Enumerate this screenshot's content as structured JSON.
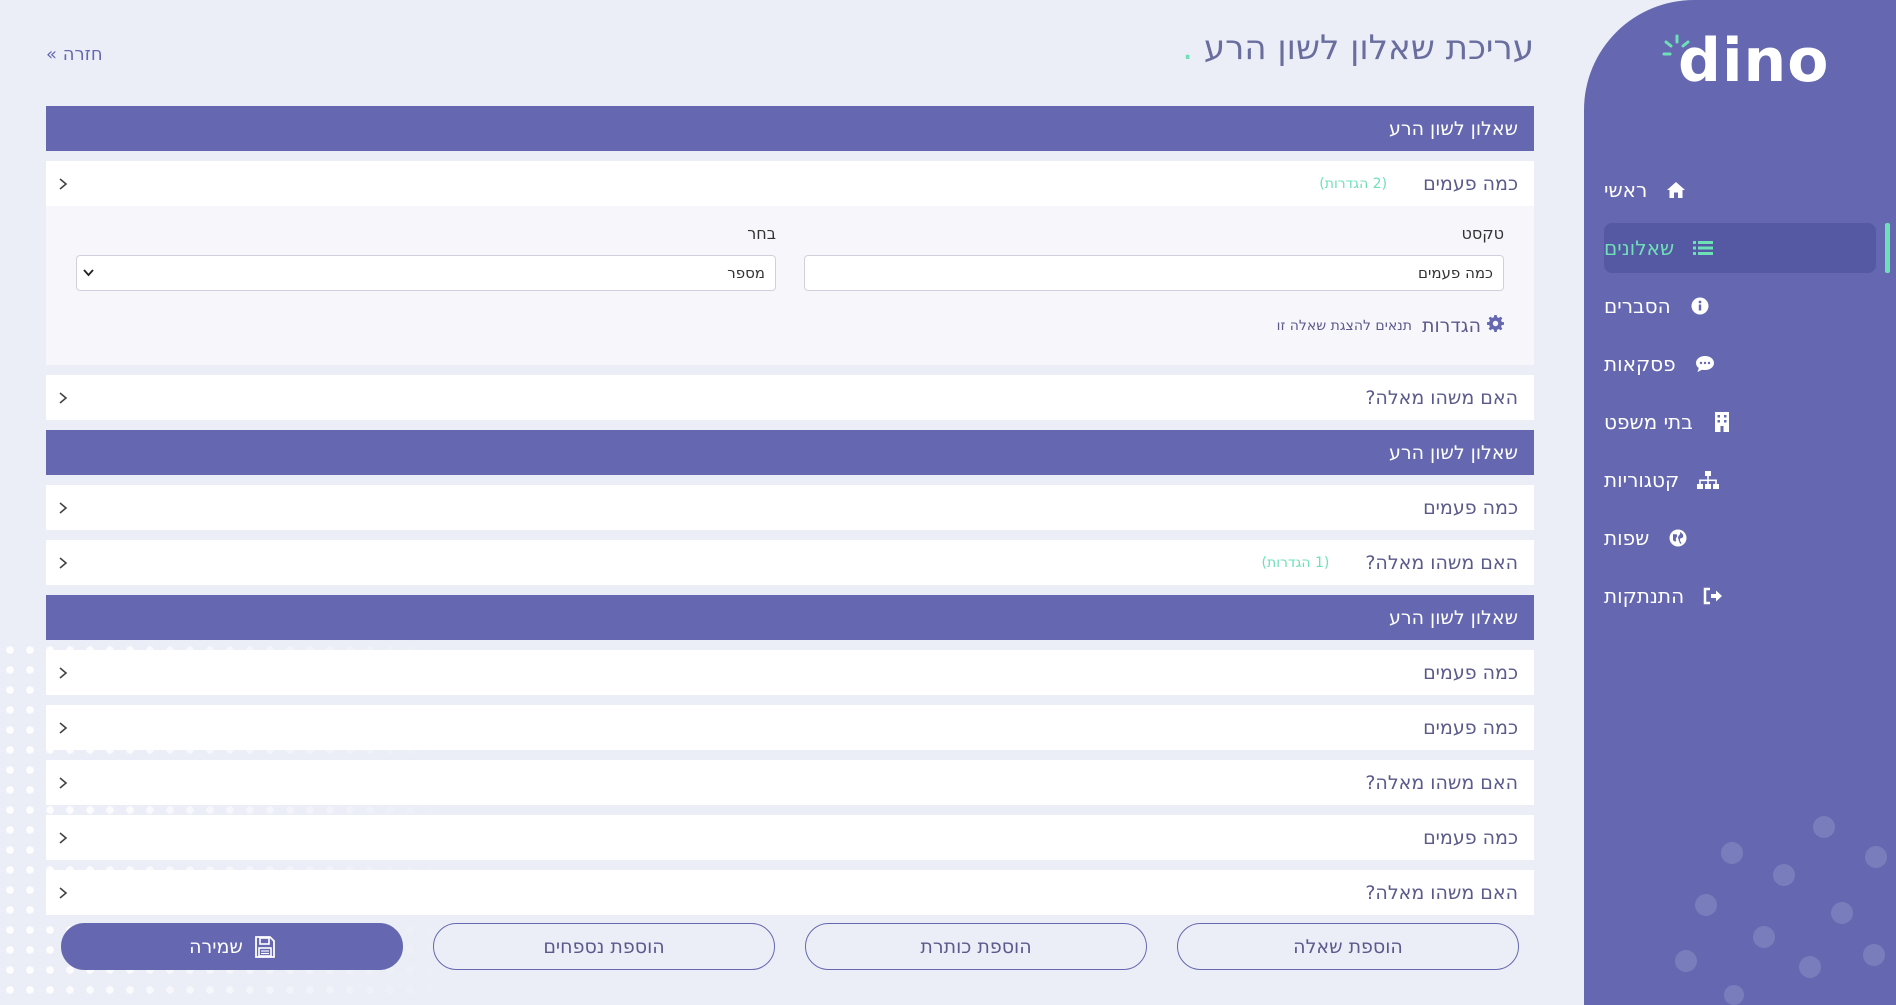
{
  "app": {
    "logo_text": "dino"
  },
  "header": {
    "title": "עריכת שאלון לשון הרע",
    "title_dot": ".",
    "back": "חזרה »"
  },
  "nav": {
    "items": [
      {
        "label": "ראשי",
        "icon": "home-icon"
      },
      {
        "label": "שאלונים",
        "icon": "list-icon",
        "active": true
      },
      {
        "label": "הסברים",
        "icon": "info-icon"
      },
      {
        "label": "פסקאות",
        "icon": "comment-icon"
      },
      {
        "label": "בתי משפט",
        "icon": "building-icon"
      },
      {
        "label": "קטגוריות",
        "icon": "sitemap-icon"
      },
      {
        "label": "שפות",
        "icon": "globe-icon"
      },
      {
        "label": "התנתקות",
        "icon": "sign-out-icon"
      }
    ]
  },
  "sections": [
    {
      "title": "שאלון לשון הרע"
    },
    {
      "title": "שאלון לשון הרע"
    },
    {
      "title": "שאלון לשון הרע"
    }
  ],
  "questions": {
    "q1": {
      "label": "כמה פעמים",
      "badge": "(2 הגדרות)"
    },
    "q2": {
      "label": "האם משהו מאלה?"
    },
    "q3": {
      "label": "כמה פעמים"
    },
    "q4": {
      "label": "האם משהו מאלה?",
      "badge": "(1 הגדרות)"
    },
    "q5": {
      "label": "כמה פעמים"
    },
    "q6": {
      "label": "כמה פעמים"
    },
    "q7": {
      "label": "האם משהו מאלה?"
    },
    "q8": {
      "label": "כמה פעמים"
    },
    "q9": {
      "label": "האם משהו מאלה?"
    }
  },
  "editor": {
    "text_label": "טקסט",
    "text_value": "כמה פעמים",
    "select_label": "בחר",
    "select_value": "מספר",
    "settings_title": "הגדרות",
    "settings_sub": "תנאים להצגת שאלה זו"
  },
  "buttons": {
    "add_question": "הוספת שאלה",
    "add_title": "הוספת כותרת",
    "add_appendix": "הוספת נספחים",
    "save": "שמירה"
  },
  "colors": {
    "accent": "#6568b0",
    "highlight": "#6ee0b8",
    "background": "#eceef7"
  }
}
